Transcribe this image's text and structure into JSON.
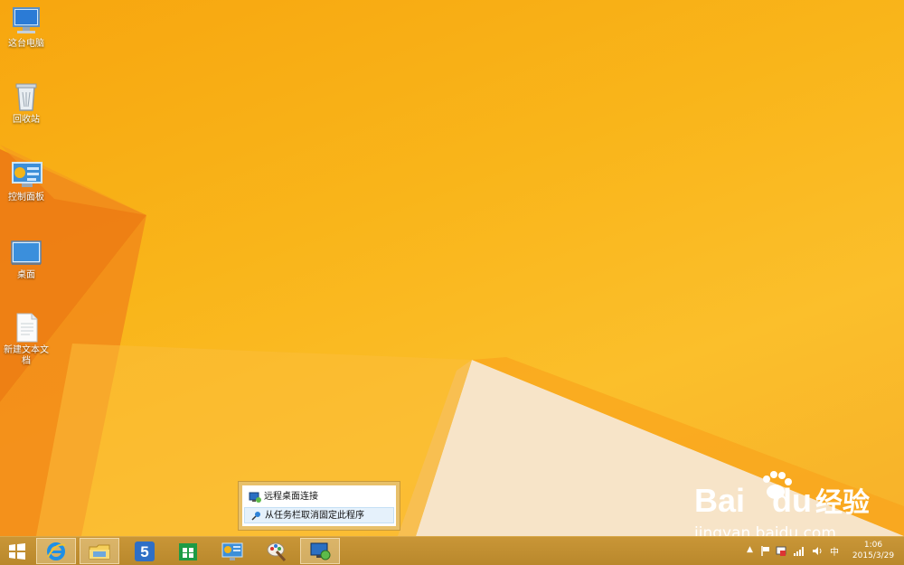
{
  "desktop_icons": [
    {
      "name": "这台电脑",
      "icon": "computer-icon"
    },
    {
      "name": "回收站",
      "icon": "recycle-bin-icon"
    },
    {
      "name": "控制面板",
      "icon": "control-panel-icon"
    },
    {
      "name": "桌面",
      "icon": "desktop-folder-icon"
    },
    {
      "name": "新建文本文档",
      "icon": "text-document-icon"
    }
  ],
  "context_menu": {
    "items": [
      {
        "label": "远程桌面连接",
        "icon": "remote-desktop-icon"
      },
      {
        "label": "从任务栏取消固定此程序",
        "icon": "unpin-icon"
      }
    ]
  },
  "taskbar": {
    "apps": [
      {
        "name": "start",
        "icon": "windows-logo-icon"
      },
      {
        "name": "internet-explorer",
        "icon": "ie-icon"
      },
      {
        "name": "file-explorer",
        "icon": "folder-icon"
      },
      {
        "name": "app-5",
        "icon": "number-5-icon"
      },
      {
        "name": "store",
        "icon": "store-icon"
      },
      {
        "name": "control-panel",
        "icon": "control-panel-icon"
      },
      {
        "name": "paint",
        "icon": "paint-icon"
      },
      {
        "name": "remote-desktop",
        "icon": "remote-desktop-icon"
      }
    ],
    "tray": {
      "ime": "中",
      "time": "1:06",
      "date": "2015/3/29"
    }
  },
  "watermark": {
    "brand": "Bai",
    "brand_du": "du",
    "brand_cn": "经验",
    "url": "jingyan.baidu.com"
  },
  "colors": {
    "wallpaper": "#f9b51a",
    "taskbar": "#c0902f",
    "menu_border": "#e8c06a",
    "menu_highlight": "#e5f1fb"
  }
}
